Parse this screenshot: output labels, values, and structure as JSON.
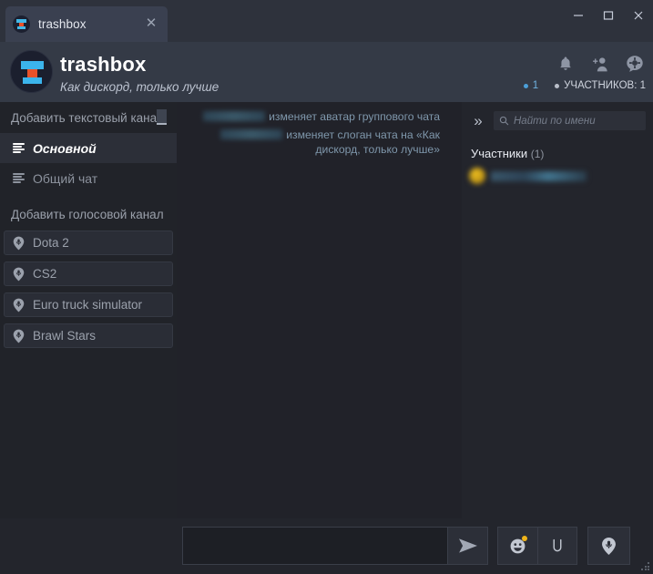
{
  "window": {
    "tab_label": "trashbox",
    "tab_close_icon": "close-icon",
    "minimize_icon": "minimize-icon",
    "maximize_icon": "maximize-icon",
    "close_icon": "close-icon"
  },
  "header": {
    "title": "trashbox",
    "subtitle": "Как дискорд, только лучше",
    "logo_icon": "trashbox-logo-icon",
    "icons": [
      "bell-icon",
      "add-person-icon",
      "settings-gear-icon"
    ],
    "online_count": "1",
    "members_label": "УЧАСТНИКОВ: 1"
  },
  "sidebar": {
    "add_text_channel": "Добавить текстовый канал",
    "text_channels": [
      {
        "label": "Основной",
        "active": true
      },
      {
        "label": "Общий чат",
        "active": false
      }
    ],
    "add_voice_channel": "Добавить голосовой канал",
    "voice_channels": [
      {
        "label": "Dota 2"
      },
      {
        "label": "CS2"
      },
      {
        "label": "Euro truck simulator"
      },
      {
        "label": "Brawl Stars"
      }
    ]
  },
  "messages": [
    {
      "username": "",
      "text": "изменяет аватар группового чата"
    },
    {
      "username": "",
      "text": "изменяет слоган чата на «Как дискорд, только лучше»"
    }
  ],
  "right_panel": {
    "collapse_icon": "double-chevron-right-icon",
    "search_placeholder": "Найти по имени",
    "search_value": "",
    "search_icon": "search-icon",
    "members_title": "Участники",
    "members_count": "(1)",
    "members": [
      {
        "name": ""
      }
    ]
  },
  "composer": {
    "input_value": "",
    "input_placeholder": "",
    "send_icon": "send-paper-plane-icon",
    "emoji_icon": "emoji-smiley-icon",
    "attach_icon": "paperclip-icon",
    "voice_icon": "voice-record-icon",
    "resize_grip_icon": "resize-grip-icon"
  },
  "colors": {
    "accent_orange": "#e8522a",
    "accent_blue": "#3bb4ec",
    "header_bg": "#343a46",
    "sidebar_bg": "#212329",
    "chat_bg": "#212229",
    "emoji_badge": "#f0b419"
  }
}
